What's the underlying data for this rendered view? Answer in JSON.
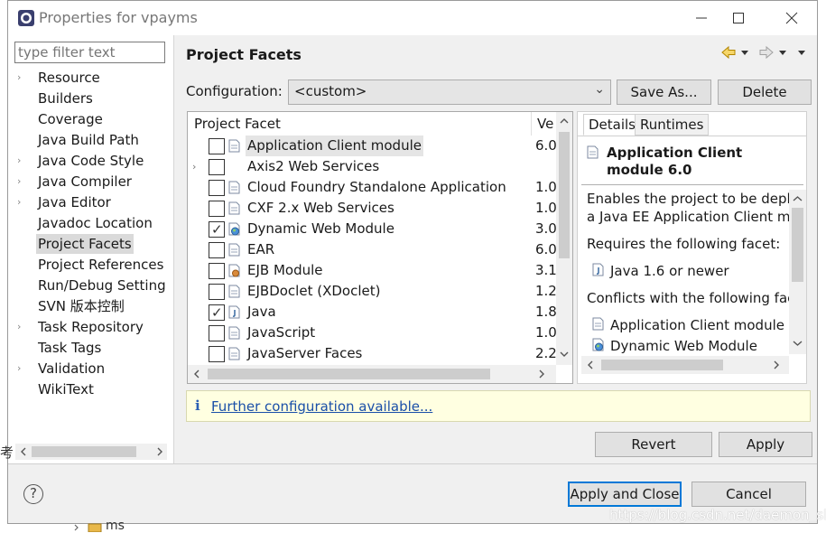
{
  "window": {
    "title": "Properties for vpayms"
  },
  "filter": {
    "placeholder": "type filter text"
  },
  "nav": {
    "items": [
      {
        "label": "Resource",
        "expandable": true
      },
      {
        "label": "Builders",
        "expandable": false
      },
      {
        "label": "Coverage",
        "expandable": false
      },
      {
        "label": "Java Build Path",
        "expandable": false
      },
      {
        "label": "Java Code Style",
        "expandable": true
      },
      {
        "label": "Java Compiler",
        "expandable": true
      },
      {
        "label": "Java Editor",
        "expandable": true
      },
      {
        "label": "Javadoc Location",
        "expandable": false
      },
      {
        "label": "Project Facets",
        "expandable": false,
        "selected": true
      },
      {
        "label": "Project References",
        "expandable": false
      },
      {
        "label": "Run/Debug Settings",
        "expandable": false
      },
      {
        "label": "SVN 版本控制",
        "expandable": false
      },
      {
        "label": "Task Repository",
        "expandable": true
      },
      {
        "label": "Task Tags",
        "expandable": false
      },
      {
        "label": "Validation",
        "expandable": true
      },
      {
        "label": "WikiText",
        "expandable": false
      }
    ]
  },
  "main": {
    "title": "Project Facets",
    "configuration_label": "Configuration:",
    "configuration_value": "<custom>",
    "save_as_label": "Save As...",
    "delete_label": "Delete"
  },
  "facets": {
    "col_facet": "Project Facet",
    "col_version": "Ve",
    "rows": [
      {
        "name": "Application Client module",
        "version": "6.0",
        "checked": false,
        "icon": "doc-icon",
        "selected": true
      },
      {
        "name": "Axis2 Web Services",
        "version": "",
        "checked": false,
        "icon": "",
        "expandable": true
      },
      {
        "name": "Cloud Foundry Standalone Application",
        "version": "1.0",
        "checked": false,
        "icon": "doc-icon"
      },
      {
        "name": "CXF 2.x Web Services",
        "version": "1.0",
        "checked": false,
        "icon": "doc-icon"
      },
      {
        "name": "Dynamic Web Module",
        "version": "3.0",
        "checked": true,
        "icon": "web-module-icon"
      },
      {
        "name": "EAR",
        "version": "6.0",
        "checked": false,
        "icon": "doc-icon"
      },
      {
        "name": "EJB Module",
        "version": "3.1",
        "checked": false,
        "icon": "ejb-icon"
      },
      {
        "name": "EJBDoclet (XDoclet)",
        "version": "1.2",
        "checked": false,
        "icon": "doc-icon"
      },
      {
        "name": "Java",
        "version": "1.8",
        "checked": true,
        "icon": "java-icon"
      },
      {
        "name": "JavaScript",
        "version": "1.0",
        "checked": false,
        "icon": "doc-icon"
      },
      {
        "name": "JavaServer Faces",
        "version": "2.2",
        "checked": false,
        "icon": "doc-icon"
      }
    ]
  },
  "details": {
    "tab_details": "Details",
    "tab_runtimes": "Runtimes",
    "heading": "Application Client module 6.0",
    "line1": "Enables the project to be deployed",
    "line2": "a Java EE Application Client module",
    "requires_label": "Requires the following facet:",
    "requires_item": "Java 1.6 or newer",
    "conflicts_label": "Conflicts with the following facets",
    "conflict_item1": "Application Client module",
    "conflict_item2": "Dynamic Web Module"
  },
  "info": {
    "link": "Further configuration available..."
  },
  "footer": {
    "revert_label": "Revert",
    "apply_label": "Apply",
    "apply_close_label": "Apply and Close",
    "cancel_label": "Cancel",
    "help": "?"
  },
  "background": {
    "folder_label": "ms",
    "watermark": "https://blog.csdn.net/daemon_slp",
    "edge_fragment": "考"
  }
}
